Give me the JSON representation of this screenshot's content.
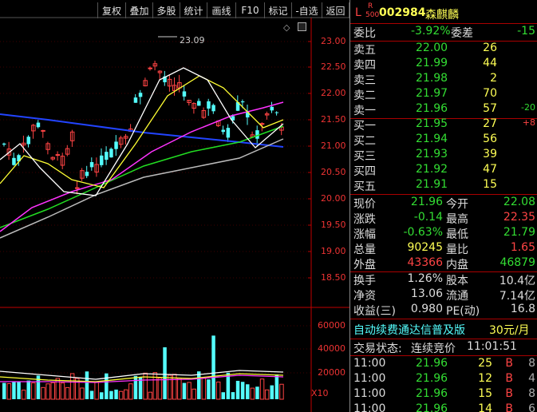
{
  "toolbar": {
    "buttons": [
      "复权",
      "叠加",
      "多股",
      "统计",
      "画线",
      "F10",
      "标记",
      "-自选",
      "返回"
    ]
  },
  "header": {
    "badge_l": "L",
    "badge_r": "R",
    "badge_500": "500",
    "code": "002984",
    "name": "森麒麟"
  },
  "chart": {
    "price_axis": [
      "23.00",
      "22.50",
      "22.00",
      "21.50",
      "21.00",
      "20.50",
      "20.00",
      "19.50",
      "19.00",
      "18.50"
    ],
    "high_label": "23.09",
    "volume_axis": [
      "60000",
      "40000",
      "20000"
    ],
    "volume_unit": "X10"
  },
  "quote": {
    "weibi_label": "委比",
    "weibi": "-3.92%",
    "weicha_label": "委差",
    "weicha": "-15",
    "asks": [
      {
        "label": "卖五",
        "price": "22.00",
        "vol": "26",
        "chg": ""
      },
      {
        "label": "卖四",
        "price": "21.99",
        "vol": "44",
        "chg": ""
      },
      {
        "label": "卖三",
        "price": "21.98",
        "vol": "2",
        "chg": ""
      },
      {
        "label": "卖二",
        "price": "21.97",
        "vol": "70",
        "chg": ""
      },
      {
        "label": "卖一",
        "price": "21.96",
        "vol": "57",
        "chg": "-20"
      }
    ],
    "bids": [
      {
        "label": "买一",
        "price": "21.95",
        "vol": "27",
        "chg": "+8"
      },
      {
        "label": "买二",
        "price": "21.94",
        "vol": "56",
        "chg": ""
      },
      {
        "label": "买三",
        "price": "21.93",
        "vol": "39",
        "chg": ""
      },
      {
        "label": "买四",
        "price": "21.92",
        "vol": "47",
        "chg": ""
      },
      {
        "label": "买五",
        "price": "21.91",
        "vol": "15",
        "chg": ""
      }
    ],
    "stats": [
      {
        "l1": "现价",
        "v1": "21.96",
        "c1": "#33dd33",
        "l2": "今开",
        "v2": "22.08",
        "c2": "#33dd33"
      },
      {
        "l1": "涨跌",
        "v1": "-0.14",
        "c1": "#33dd33",
        "l2": "最高",
        "v2": "22.35",
        "c2": "#ff4444"
      },
      {
        "l1": "涨幅",
        "v1": "-0.63%",
        "c1": "#33dd33",
        "l2": "最低",
        "v2": "21.79",
        "c2": "#33dd33"
      },
      {
        "l1": "总量",
        "v1": "90245",
        "c1": "#ffff55",
        "l2": "量比",
        "v2": "1.65",
        "c2": "#ff4444"
      },
      {
        "l1": "外盘",
        "v1": "43366",
        "c1": "#ff4444",
        "l2": "内盘",
        "v2": "46879",
        "c2": "#33dd33"
      }
    ],
    "fundamentals": [
      {
        "l1": "换手",
        "v1": "1.26%",
        "l2": "股本",
        "v2": "10.4亿"
      },
      {
        "l1": "净资",
        "v1": "13.06",
        "l2": "流通",
        "v2": "7.14亿"
      },
      {
        "l1": "收益(三)",
        "v1": "0.980",
        "l2": "PE(动)",
        "v2": "16.8"
      }
    ],
    "ad_text": "自动续费通达信普及版",
    "ad_price": "30元/月",
    "status_label": "交易状态:",
    "status_value": "连续竞价",
    "status_time": "11:01:51",
    "ticks": [
      {
        "time": "11:00",
        "price": "21.96",
        "vol": "25",
        "side": "B",
        "n": "8"
      },
      {
        "time": "11:00",
        "price": "21.96",
        "vol": "12",
        "side": "B",
        "n": "4"
      },
      {
        "time": "11:00",
        "price": "21.96",
        "vol": "15",
        "side": "B",
        "n": "8"
      },
      {
        "time": "11:00",
        "price": "21.96",
        "vol": "14",
        "side": "B",
        "n": "6"
      }
    ]
  },
  "colors": {
    "up": "#ff4444",
    "down": "#33dd33",
    "cyan": "#54fcfc",
    "axis": "#c00000",
    "ma_white": "#ffffff",
    "ma_yellow": "#ffff33",
    "ma_magenta": "#ff33ff",
    "ma_green": "#22dd22",
    "ma_gray": "#bbbbbb",
    "ma_blue": "#2244ff"
  }
}
